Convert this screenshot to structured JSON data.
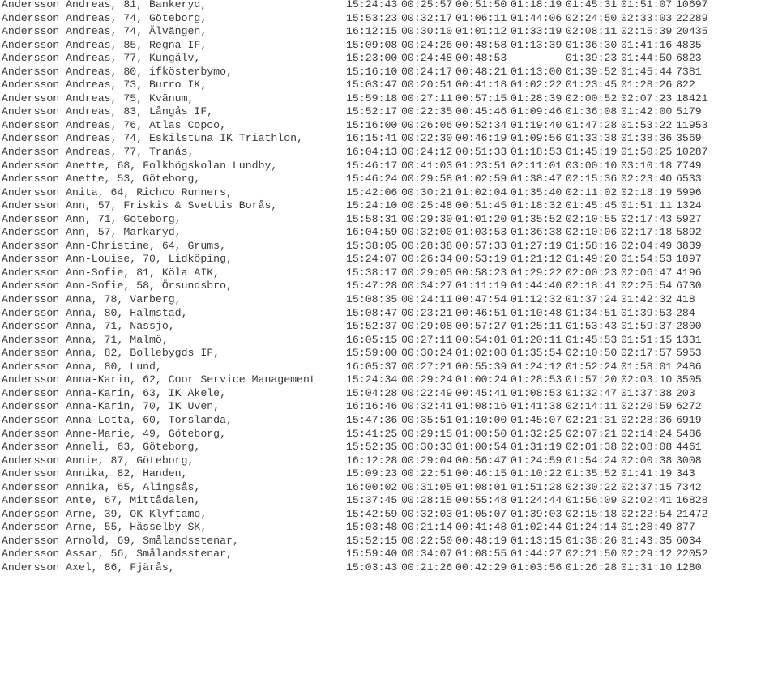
{
  "results": [
    {
      "name": "Andersson Andreas, 81, Bankeryd,",
      "start": "15:24:43",
      "split1": "00:25:57",
      "split2": "00:51:50",
      "split3": "01:18:19",
      "split4": "01:45:31",
      "finish": "01:51:07",
      "place": "10697"
    },
    {
      "name": "Andersson Andreas, 74, Göteborg,",
      "start": "15:53:23",
      "split1": "00:32:17",
      "split2": "01:06:11",
      "split3": "01:44:06",
      "split4": "02:24:50",
      "finish": "02:33:03",
      "place": "22289"
    },
    {
      "name": "Andersson Andreas, 74, Älvängen,",
      "start": "16:12:15",
      "split1": "00:30:10",
      "split2": "01:01:12",
      "split3": "01:33:19",
      "split4": "02:08:11",
      "finish": "02:15:39",
      "place": "20435"
    },
    {
      "name": "Andersson Andreas, 85, Regna IF,",
      "start": "15:09:08",
      "split1": "00:24:26",
      "split2": "00:48:58",
      "split3": "01:13:39",
      "split4": "01:36:30",
      "finish": "01:41:16",
      "place": "4835"
    },
    {
      "name": "Andersson Andreas, 77, Kungälv,",
      "start": "15:23:00",
      "split1": "00:24:48",
      "split2": "00:48:53",
      "split3": "",
      "split4": "01:39:23",
      "finish": "01:44:50",
      "place": "6823"
    },
    {
      "name": "Andersson Andreas, 80, ifkösterbymo,",
      "start": "15:16:10",
      "split1": "00:24:17",
      "split2": "00:48:21",
      "split3": "01:13:00",
      "split4": "01:39:52",
      "finish": "01:45:44",
      "place": "7381"
    },
    {
      "name": "Andersson Andreas, 73, Burro IK,",
      "start": "15:03:47",
      "split1": "00:20:51",
      "split2": "00:41:18",
      "split3": "01:02:22",
      "split4": "01:23:45",
      "finish": "01:28:26",
      "place": "822"
    },
    {
      "name": "Andersson Andreas, 75, Kvänum,",
      "start": "15:59:18",
      "split1": "00:27:11",
      "split2": "00:57:15",
      "split3": "01:28:39",
      "split4": "02:00:52",
      "finish": "02:07:23",
      "place": "18421"
    },
    {
      "name": "Andersson Andreas, 83, Långås IF,",
      "start": "15:52:17",
      "split1": "00:22:35",
      "split2": "00:45:46",
      "split3": "01:09:46",
      "split4": "01:36:08",
      "finish": "01:42:00",
      "place": "5179"
    },
    {
      "name": "Andersson Andreas, 76, Atlas Copco,",
      "start": "15:16:00",
      "split1": "00:26:06",
      "split2": "00:52:34",
      "split3": "01:19:40",
      "split4": "01:47:28",
      "finish": "01:53:22",
      "place": "11953"
    },
    {
      "name": "Andersson Andreas, 74, Eskilstuna IK Triathlon,",
      "start": "16:15:41",
      "split1": "00:22:30",
      "split2": "00:46:19",
      "split3": "01:09:56",
      "split4": "01:33:38",
      "finish": "01:38:36",
      "place": "3569"
    },
    {
      "name": "Andersson Andreas, 77, Tranås,",
      "start": "16:04:13",
      "split1": "00:24:12",
      "split2": "00:51:33",
      "split3": "01:18:53",
      "split4": "01:45:19",
      "finish": "01:50:25",
      "place": "10287"
    },
    {
      "name": "Andersson Anette, 68, Folkhögskolan Lundby,",
      "start": "15:46:17",
      "split1": "00:41:03",
      "split2": "01:23:51",
      "split3": "02:11:01",
      "split4": "03:00:10",
      "finish": "03:10:18",
      "place": "7749"
    },
    {
      "name": "Andersson Anette, 53, Göteborg,",
      "start": "15:46:24",
      "split1": "00:29:58",
      "split2": "01:02:59",
      "split3": "01:38:47",
      "split4": "02:15:36",
      "finish": "02:23:40",
      "place": "6533"
    },
    {
      "name": "Andersson Anita, 64, Richco Runners,",
      "start": "15:42:06",
      "split1": "00:30:21",
      "split2": "01:02:04",
      "split3": "01:35:40",
      "split4": "02:11:02",
      "finish": "02:18:19",
      "place": "5996"
    },
    {
      "name": "Andersson Ann, 57, Friskis & Svettis Borås,",
      "start": "15:24:10",
      "split1": "00:25:48",
      "split2": "00:51:45",
      "split3": "01:18:32",
      "split4": "01:45:45",
      "finish": "01:51:11",
      "place": "1324"
    },
    {
      "name": "Andersson Ann, 71, Göteborg,",
      "start": "15:58:31",
      "split1": "00:29:30",
      "split2": "01:01:20",
      "split3": "01:35:52",
      "split4": "02:10:55",
      "finish": "02:17:43",
      "place": "5927"
    },
    {
      "name": "Andersson Ann, 57, Markaryd,",
      "start": "16:04:59",
      "split1": "00:32:00",
      "split2": "01:03:53",
      "split3": "01:36:38",
      "split4": "02:10:06",
      "finish": "02:17:18",
      "place": "5892"
    },
    {
      "name": "Andersson Ann-Christine, 64, Grums,",
      "start": "15:38:05",
      "split1": "00:28:38",
      "split2": "00:57:33",
      "split3": "01:27:19",
      "split4": "01:58:16",
      "finish": "02:04:49",
      "place": "3839"
    },
    {
      "name": "Andersson Ann-Louise, 70, Lidköping,",
      "start": "15:24:07",
      "split1": "00:26:34",
      "split2": "00:53:19",
      "split3": "01:21:12",
      "split4": "01:49:20",
      "finish": "01:54:53",
      "place": "1897"
    },
    {
      "name": "Andersson Ann-Sofie, 81, Köla AIK,",
      "start": "15:38:17",
      "split1": "00:29:05",
      "split2": "00:58:23",
      "split3": "01:29:22",
      "split4": "02:00:23",
      "finish": "02:06:47",
      "place": "4196"
    },
    {
      "name": "Andersson Ann-Sofie, 58, Örsundsbro,",
      "start": "15:47:28",
      "split1": "00:34:27",
      "split2": "01:11:19",
      "split3": "01:44:40",
      "split4": "02:18:41",
      "finish": "02:25:54",
      "place": "6730"
    },
    {
      "name": "Andersson Anna, 78, Varberg,",
      "start": "15:08:35",
      "split1": "00:24:11",
      "split2": "00:47:54",
      "split3": "01:12:32",
      "split4": "01:37:24",
      "finish": "01:42:32",
      "place": "418"
    },
    {
      "name": "Andersson Anna, 80, Halmstad,",
      "start": "15:08:47",
      "split1": "00:23:21",
      "split2": "00:46:51",
      "split3": "01:10:48",
      "split4": "01:34:51",
      "finish": "01:39:53",
      "place": "284"
    },
    {
      "name": "Andersson Anna, 71, Nässjö,",
      "start": "15:52:37",
      "split1": "00:29:08",
      "split2": "00:57:27",
      "split3": "01:25:11",
      "split4": "01:53:43",
      "finish": "01:59:37",
      "place": "2800"
    },
    {
      "name": "Andersson Anna, 71, Malmö,",
      "start": "16:05:15",
      "split1": "00:27:11",
      "split2": "00:54:01",
      "split3": "01:20:11",
      "split4": "01:45:53",
      "finish": "01:51:15",
      "place": "1331"
    },
    {
      "name": "Andersson Anna, 82, Bollebygds IF,",
      "start": "15:59:00",
      "split1": "00:30:24",
      "split2": "01:02:08",
      "split3": "01:35:54",
      "split4": "02:10:50",
      "finish": "02:17:57",
      "place": "5953"
    },
    {
      "name": "Andersson Anna, 80, Lund,",
      "start": "16:05:37",
      "split1": "00:27:21",
      "split2": "00:55:39",
      "split3": "01:24:12",
      "split4": "01:52:24",
      "finish": "01:58:01",
      "place": "2486"
    },
    {
      "name": "Andersson Anna-Karin, 62, Coor Service Management",
      "start": "15:24:34",
      "split1": "00:29:24",
      "split2": "01:00:24",
      "split3": "01:28:53",
      "split4": "01:57:20",
      "finish": "02:03:10",
      "place": "3505"
    },
    {
      "name": "Andersson Anna-Karin, 63, IK Akele,",
      "start": "15:04:28",
      "split1": "00:22:49",
      "split2": "00:45:41",
      "split3": "01:08:53",
      "split4": "01:32:47",
      "finish": "01:37:38",
      "place": "203"
    },
    {
      "name": "Andersson Anna-Karin, 70, IK Uven,",
      "start": "16:16:46",
      "split1": "00:32:41",
      "split2": "01:08:16",
      "split3": "01:41:38",
      "split4": "02:14:11",
      "finish": "02:20:59",
      "place": "6272"
    },
    {
      "name": "Andersson Anna-Lotta, 60, Torslanda,",
      "start": "15:47:36",
      "split1": "00:35:51",
      "split2": "01:10:00",
      "split3": "01:45:07",
      "split4": "02:21:31",
      "finish": "02:28:36",
      "place": "6919"
    },
    {
      "name": "Andersson Anne-Marie, 49, Göteborg,",
      "start": "15:41:25",
      "split1": "00:29:15",
      "split2": "01:00:50",
      "split3": "01:32:25",
      "split4": "02:07:21",
      "finish": "02:14:24",
      "place": "5486"
    },
    {
      "name": "Andersson Anneli, 63, Göteborg,",
      "start": "15:52:35",
      "split1": "00:30:33",
      "split2": "01:00:54",
      "split3": "01:31:19",
      "split4": "02:01:38",
      "finish": "02:08:08",
      "place": "4461"
    },
    {
      "name": "Andersson Annie, 87, Göteborg,",
      "start": "16:12:28",
      "split1": "00:29:04",
      "split2": "00:56:47",
      "split3": "01:24:59",
      "split4": "01:54:24",
      "finish": "02:00:38",
      "place": "3008"
    },
    {
      "name": "Andersson Annika, 82, Handen,",
      "start": "15:09:23",
      "split1": "00:22:51",
      "split2": "00:46:15",
      "split3": "01:10:22",
      "split4": "01:35:52",
      "finish": "01:41:19",
      "place": "343"
    },
    {
      "name": "Andersson Annika, 65, Alingsås,",
      "start": "16:00:02",
      "split1": "00:31:05",
      "split2": "01:08:01",
      "split3": "01:51:28",
      "split4": "02:30:22",
      "finish": "02:37:15",
      "place": "7342"
    },
    {
      "name": "Andersson Ante, 67, Mittådalen,",
      "start": "15:37:45",
      "split1": "00:28:15",
      "split2": "00:55:48",
      "split3": "01:24:44",
      "split4": "01:56:09",
      "finish": "02:02:41",
      "place": "16828"
    },
    {
      "name": "Andersson Arne, 39, OK Klyftamo,",
      "start": "15:42:59",
      "split1": "00:32:03",
      "split2": "01:05:07",
      "split3": "01:39:03",
      "split4": "02:15:18",
      "finish": "02:22:54",
      "place": "21472"
    },
    {
      "name": "Andersson Arne, 55, Hässelby SK,",
      "start": "15:03:48",
      "split1": "00:21:14",
      "split2": "00:41:48",
      "split3": "01:02:44",
      "split4": "01:24:14",
      "finish": "01:28:49",
      "place": "877"
    },
    {
      "name": "Andersson Arnold, 69, Smålandsstenar,",
      "start": "15:52:15",
      "split1": "00:22:50",
      "split2": "00:48:19",
      "split3": "01:13:15",
      "split4": "01:38:26",
      "finish": "01:43:35",
      "place": "6034"
    },
    {
      "name": "Andersson Assar, 56, Smålandsstenar,",
      "start": "15:59:40",
      "split1": "00:34:07",
      "split2": "01:08:55",
      "split3": "01:44:27",
      "split4": "02:21:50",
      "finish": "02:29:12",
      "place": "22052"
    },
    {
      "name": "Andersson Axel, 86, Fjärås,",
      "start": "15:03:43",
      "split1": "00:21:26",
      "split2": "00:42:29",
      "split3": "01:03:56",
      "split4": "01:26:28",
      "finish": "01:31:10",
      "place": "1280"
    }
  ]
}
